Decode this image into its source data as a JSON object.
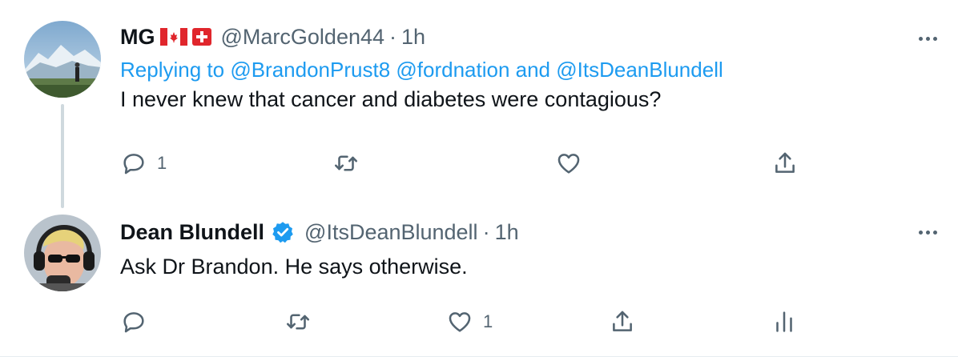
{
  "tweets": [
    {
      "display_name": "MG",
      "flags": [
        "canada-flag-icon",
        "swiss-flag-icon"
      ],
      "handle": "@MarcGolden44",
      "separator": "·",
      "time": "1h",
      "replying_label": "Replying to",
      "replying_to": "@BrandonPrust8 @fordnation and @ItsDeanBlundell",
      "text": "I never knew that cancer and diabetes were contagious?",
      "actions": {
        "reply_count": "1",
        "retweet_count": "",
        "like_count": ""
      }
    },
    {
      "display_name": "Dean Blundell",
      "verified": true,
      "handle": "@ItsDeanBlundell",
      "separator": "·",
      "time": "1h",
      "text": "Ask Dr Brandon. He says otherwise.",
      "actions": {
        "reply_count": "",
        "retweet_count": "",
        "like_count": "1"
      }
    }
  ],
  "colors": {
    "accent": "#1d9bf0",
    "muted": "#536471",
    "text": "#0f1419",
    "thread_line": "#cfd9de"
  },
  "icons": [
    "reply-icon",
    "retweet-icon",
    "like-icon",
    "share-icon",
    "analytics-icon",
    "more-icon",
    "verified-icon"
  ]
}
